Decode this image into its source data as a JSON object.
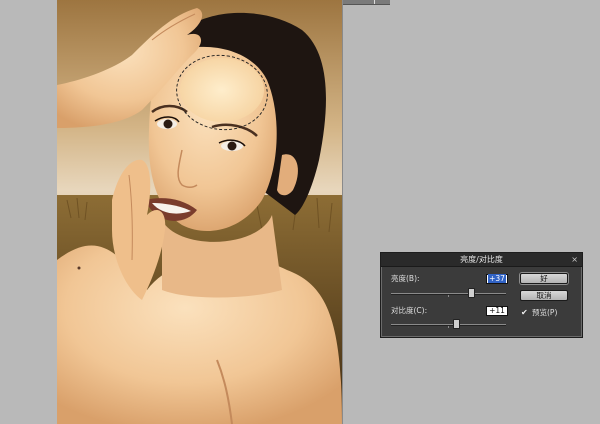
{
  "dialog": {
    "title": "亮度/对比度",
    "close_glyph": "×",
    "brightness": {
      "label": "亮度(B):",
      "value": "+37"
    },
    "contrast": {
      "label": "对比度(C):",
      "value": "+11"
    },
    "buttons": {
      "ok": "好",
      "cancel": "取消"
    },
    "preview": {
      "checkmark": "✔",
      "label": "预览(P)",
      "checked": true
    }
  },
  "icons": [
    "close-icon",
    "checkbox-checked-icon"
  ],
  "colors": {
    "dialog_bg": "#3b3b3b",
    "title_bar": "#2a2a2a",
    "workspace": "#b9b9b9",
    "selected_text": "#3163c5"
  }
}
